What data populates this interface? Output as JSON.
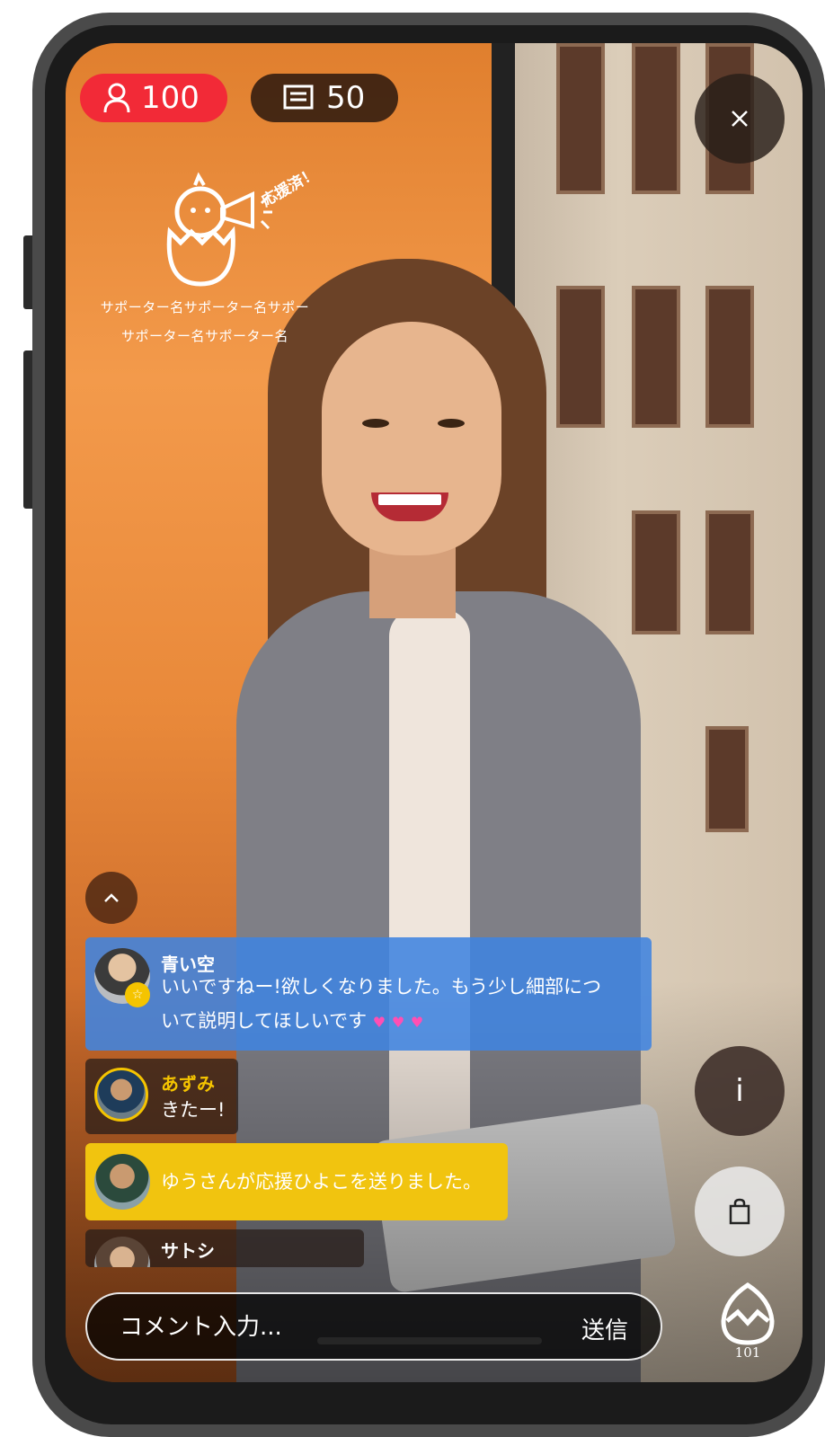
{
  "stream": {
    "viewer_count": "100",
    "comment_count": "50"
  },
  "supporter_banner": {
    "cheered_label": "応援済！",
    "line1": "サポーター名サポーター名サポー",
    "line2": "サポーター名サポーター名"
  },
  "chat": {
    "messages": [
      {
        "user": "青い空",
        "text_line1": "いいですねー!欲しくなりました。もう少し細部につ",
        "text_line2": "いて説明してほしいです"
      },
      {
        "user": "あずみ",
        "text": "きたー!"
      },
      {
        "text": "ゆうさんが応援ひよこを送りました。"
      },
      {
        "user": "サトシ"
      }
    ],
    "blue_color": "#4084e0",
    "yellow_color": "#f1c40f",
    "name_highlight_color": "#f5c400"
  },
  "composer": {
    "placeholder": "コメント入力...",
    "send_label": "送信"
  },
  "egg": {
    "count": "101"
  },
  "icons": {
    "viewers": "person-icon",
    "comments": "comment-list-icon",
    "close": "close-icon",
    "chick": "chick-megaphone-icon",
    "up": "chevron-up-icon",
    "info": "info-icon",
    "bag": "shopping-bag-icon",
    "egg": "egg-icon",
    "hearts": "heart-icon"
  },
  "colors": {
    "live_red": "#f22a37",
    "dark_chip": "#2a180e"
  }
}
